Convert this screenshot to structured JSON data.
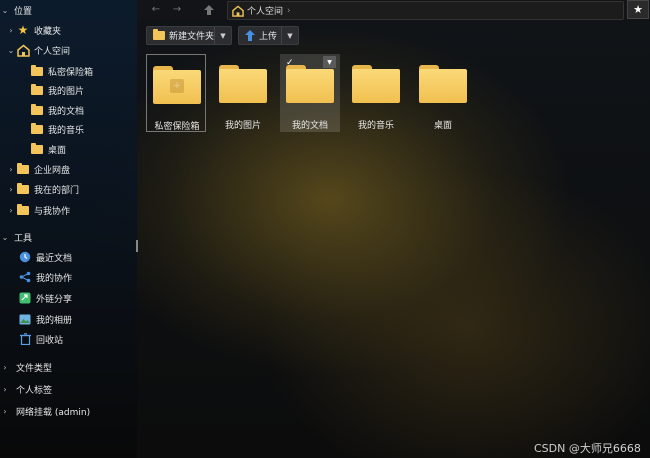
{
  "sidebar": {
    "location_header": "位置",
    "favorites": "收藏夹",
    "personal_space": "个人空间",
    "personal_items": [
      "私密保险箱",
      "我的图片",
      "我的文档",
      "我的音乐",
      "桌面"
    ],
    "enterprise": "企业网盘",
    "my_department": "我在的部门",
    "collab_with_me": "与我协作",
    "tools_header": "工具",
    "tools": [
      "最近文档",
      "我的协作",
      "外链分享",
      "我的相册",
      "回收站"
    ],
    "file_types": "文件类型",
    "personal_tags": "个人标签",
    "network_mount": "网络挂载 (admin)"
  },
  "toolbar": {
    "breadcrumb": "个人空间",
    "new_folder": "新建文件夹",
    "upload": "上传"
  },
  "folders": [
    "私密保险箱",
    "我的图片",
    "我的文档",
    "我的音乐",
    "桌面"
  ],
  "watermark": "CSDN @大师兄6668",
  "colors": {
    "folder": "#f2c45a",
    "accent": "#4a90e2"
  }
}
